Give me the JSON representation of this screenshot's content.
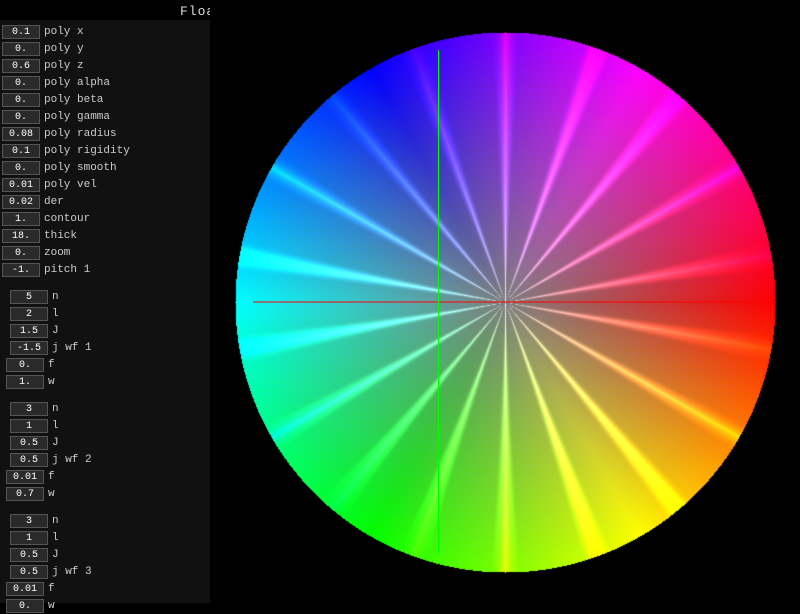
{
  "title": "Floating Sail",
  "params": [
    {
      "value": "0.1",
      "label": "poly x"
    },
    {
      "value": "0.",
      "label": "poly y"
    },
    {
      "value": "0.6",
      "label": "poly z"
    },
    {
      "value": "0.",
      "label": "poly alpha"
    },
    {
      "value": "0.",
      "label": "poly beta"
    },
    {
      "value": "0.",
      "label": "poly gamma"
    },
    {
      "value": "0.08",
      "label": "poly radius"
    },
    {
      "value": "0.1",
      "label": "poly rigidity"
    },
    {
      "value": "0.",
      "label": "poly smooth"
    },
    {
      "value": "0.01",
      "label": "poly vel"
    },
    {
      "value": "0.02",
      "label": "der"
    },
    {
      "value": "1.",
      "label": "contour"
    },
    {
      "value": "18.",
      "label": "thick"
    },
    {
      "value": "0.",
      "label": "zoom"
    },
    {
      "value": "-1.",
      "label": "pitch 1"
    }
  ],
  "wf1": {
    "label": "wf 1",
    "rows": [
      {
        "value": "5",
        "param": "n"
      },
      {
        "value": "2",
        "param": "l"
      },
      {
        "value": "1.5",
        "param": "J"
      },
      {
        "value": "-1.5",
        "param": "j"
      }
    ],
    "f_value": "0.",
    "w_value": "1."
  },
  "wf2": {
    "label": "wf 2",
    "rows": [
      {
        "value": "3",
        "param": "n"
      },
      {
        "value": "1",
        "param": "l"
      },
      {
        "value": "0.5",
        "param": "J"
      },
      {
        "value": "0.5",
        "param": "j"
      }
    ],
    "f_value": "0.01",
    "w_value": "0.7"
  },
  "wf3": {
    "label": "wf 3",
    "rows": [
      {
        "value": "3",
        "param": "n"
      },
      {
        "value": "1",
        "param": "l"
      },
      {
        "value": "0.5",
        "param": "J"
      },
      {
        "value": "0.5",
        "param": "j"
      }
    ],
    "f_value": "0.01",
    "w_value": "0."
  }
}
